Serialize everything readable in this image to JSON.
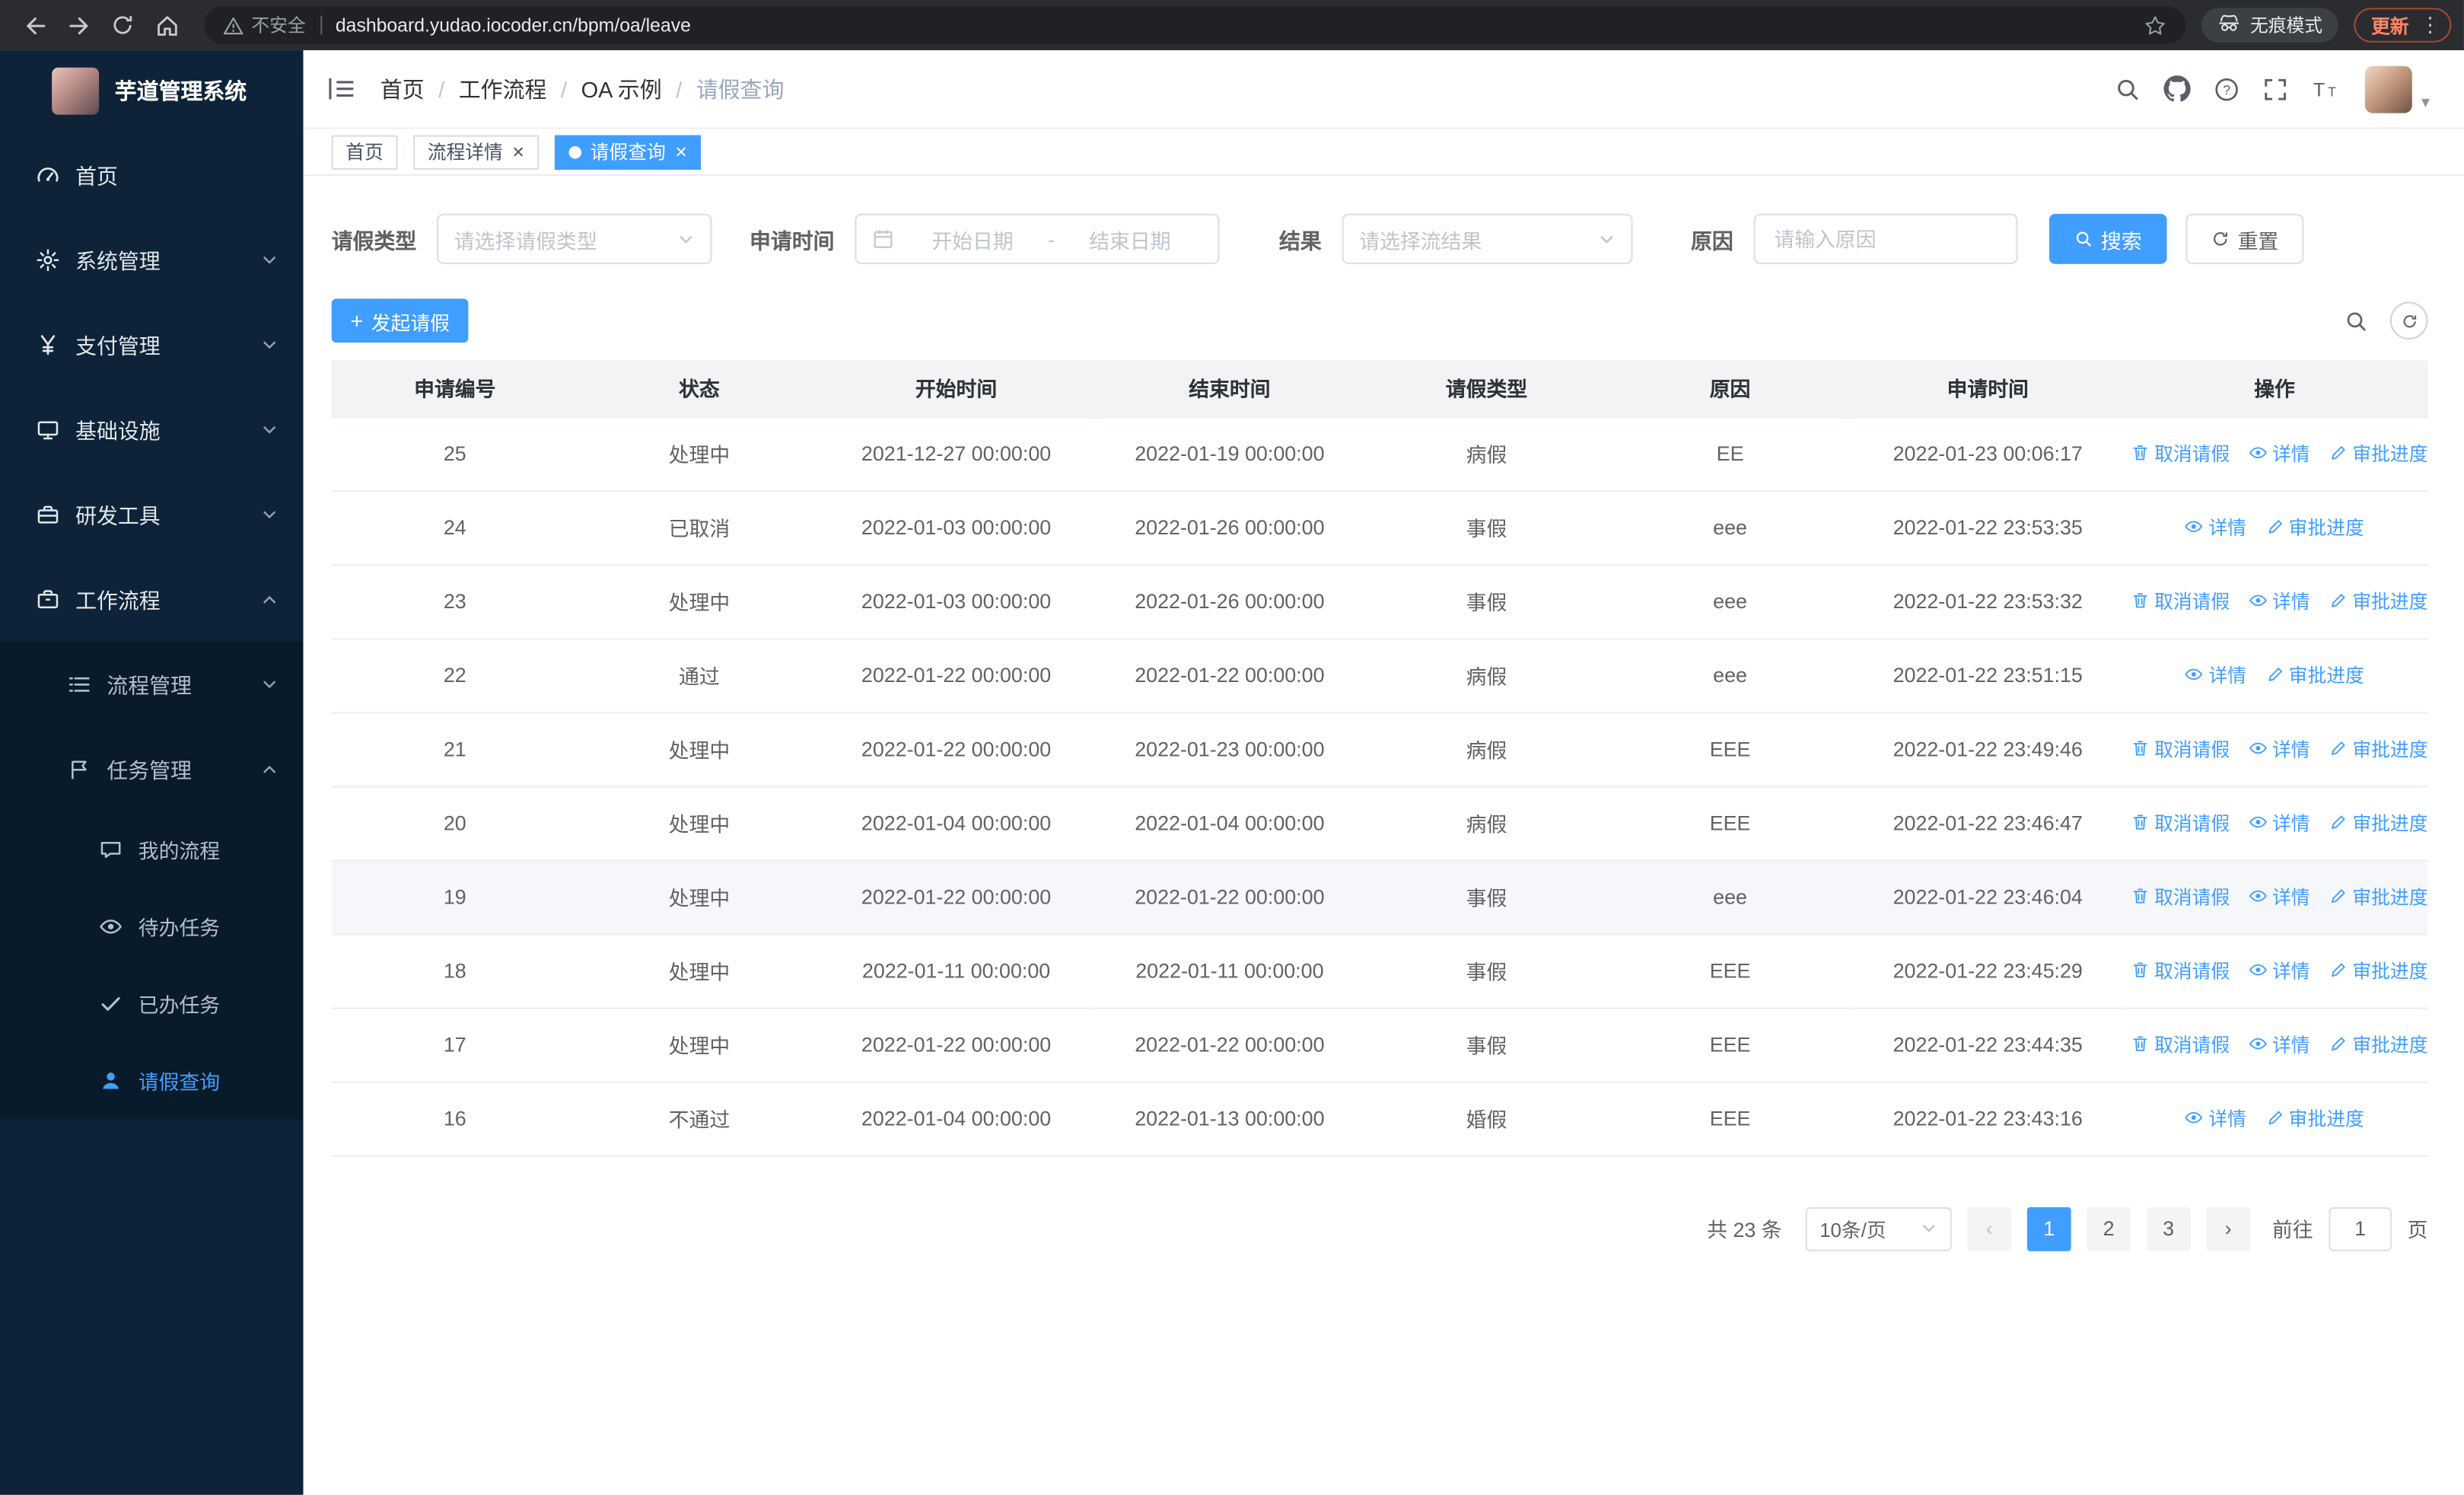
{
  "browser": {
    "security_label": "不安全",
    "url": "dashboard.yudao.iocoder.cn/bpm/oa/leave",
    "incognito_label": "无痕模式",
    "update_label": "更新"
  },
  "sidebar": {
    "logo_title": "芋道管理系统",
    "items": [
      {
        "name": "home",
        "label": "首页",
        "icon": "dashboard-icon",
        "level": 1
      },
      {
        "name": "system",
        "label": "系统管理",
        "icon": "gear-icon",
        "level": 1,
        "chevron": "down"
      },
      {
        "name": "payment",
        "label": "支付管理",
        "icon": "yen-icon",
        "level": 1,
        "chevron": "down"
      },
      {
        "name": "infrastructure",
        "label": "基础设施",
        "icon": "infra-icon",
        "level": 1,
        "chevron": "down"
      },
      {
        "name": "dev-tools",
        "label": "研发工具",
        "icon": "toolbox-icon",
        "level": 1,
        "chevron": "down"
      },
      {
        "name": "workflow",
        "label": "工作流程",
        "icon": "briefcase-icon",
        "level": 1,
        "chevron": "up"
      },
      {
        "name": "process-mgmt",
        "label": "流程管理",
        "icon": "list-icon",
        "level": 2,
        "chevron": "down"
      },
      {
        "name": "task-mgmt",
        "label": "任务管理",
        "icon": "flag-icon",
        "level": 2,
        "chevron": "up"
      },
      {
        "name": "my-process",
        "label": "我的流程",
        "icon": "chat-icon",
        "level": 3
      },
      {
        "name": "todo-tasks",
        "label": "待办任务",
        "icon": "eye-icon",
        "level": 3
      },
      {
        "name": "done-tasks",
        "label": "已办任务",
        "icon": "check-icon",
        "level": 3
      },
      {
        "name": "leave-query",
        "label": "请假查询",
        "icon": "user-icon",
        "level": 3,
        "active": true
      }
    ]
  },
  "header": {
    "breadcrumb": [
      "首页",
      "工作流程",
      "OA 示例",
      "请假查询"
    ]
  },
  "tabs": [
    {
      "label": "首页",
      "closable": false,
      "active": false
    },
    {
      "label": "流程详情",
      "closable": true,
      "active": false
    },
    {
      "label": "请假查询",
      "closable": true,
      "active": true
    }
  ],
  "filters": {
    "type_label": "请假类型",
    "type_placeholder": "请选择请假类型",
    "time_label": "申请时间",
    "start_placeholder": "开始日期",
    "separator": "-",
    "end_placeholder": "结束日期",
    "result_label": "结果",
    "result_placeholder": "请选择流结果",
    "reason_label": "原因",
    "reason_placeholder": "请输入原因",
    "search_label": "搜索",
    "reset_label": "重置"
  },
  "toolbar": {
    "create_label": "发起请假"
  },
  "table": {
    "columns": [
      "申请编号",
      "状态",
      "开始时间",
      "结束时间",
      "请假类型",
      "原因",
      "申请时间",
      "操作"
    ],
    "ops": {
      "cancel": "取消请假",
      "detail": "详情",
      "progress": "审批进度"
    },
    "rows": [
      {
        "id": "25",
        "status": "处理中",
        "start": "2021-12-27 00:00:00",
        "end": "2022-01-19 00:00:00",
        "type": "病假",
        "reason": "EE",
        "applied": "2022-01-23 00:06:17",
        "cancelable": true
      },
      {
        "id": "24",
        "status": "已取消",
        "start": "2022-01-03 00:00:00",
        "end": "2022-01-26 00:00:00",
        "type": "事假",
        "reason": "eee",
        "applied": "2022-01-22 23:53:35",
        "cancelable": false
      },
      {
        "id": "23",
        "status": "处理中",
        "start": "2022-01-03 00:00:00",
        "end": "2022-01-26 00:00:00",
        "type": "事假",
        "reason": "eee",
        "applied": "2022-01-22 23:53:32",
        "cancelable": true
      },
      {
        "id": "22",
        "status": "通过",
        "start": "2022-01-22 00:00:00",
        "end": "2022-01-22 00:00:00",
        "type": "病假",
        "reason": "eee",
        "applied": "2022-01-22 23:51:15",
        "cancelable": false
      },
      {
        "id": "21",
        "status": "处理中",
        "start": "2022-01-22 00:00:00",
        "end": "2022-01-23 00:00:00",
        "type": "病假",
        "reason": "EEE",
        "applied": "2022-01-22 23:49:46",
        "cancelable": true
      },
      {
        "id": "20",
        "status": "处理中",
        "start": "2022-01-04 00:00:00",
        "end": "2022-01-04 00:00:00",
        "type": "病假",
        "reason": "EEE",
        "applied": "2022-01-22 23:46:47",
        "cancelable": true
      },
      {
        "id": "19",
        "status": "处理中",
        "start": "2022-01-22 00:00:00",
        "end": "2022-01-22 00:00:00",
        "type": "事假",
        "reason": "eee",
        "applied": "2022-01-22 23:46:04",
        "cancelable": true,
        "hovered": true
      },
      {
        "id": "18",
        "status": "处理中",
        "start": "2022-01-11 00:00:00",
        "end": "2022-01-11 00:00:00",
        "type": "事假",
        "reason": "EEE",
        "applied": "2022-01-22 23:45:29",
        "cancelable": true
      },
      {
        "id": "17",
        "status": "处理中",
        "start": "2022-01-22 00:00:00",
        "end": "2022-01-22 00:00:00",
        "type": "事假",
        "reason": "EEE",
        "applied": "2022-01-22 23:44:35",
        "cancelable": true
      },
      {
        "id": "16",
        "status": "不通过",
        "start": "2022-01-04 00:00:00",
        "end": "2022-01-13 00:00:00",
        "type": "婚假",
        "reason": "EEE",
        "applied": "2022-01-22 23:43:16",
        "cancelable": false
      }
    ]
  },
  "pagination": {
    "total_label": "共 23 条",
    "page_size_label": "10条/页",
    "prev_label": "‹",
    "pages": [
      "1",
      "2",
      "3"
    ],
    "active_page": "1",
    "next_label": "›",
    "goto_label": "前往",
    "goto_value": "1",
    "unit_label": "页"
  },
  "colors": {
    "accent": "#409eff",
    "sidebar_bg": "#0e2338",
    "submenu_bg": "#091a2b",
    "table_header_bg": "#f1f3f5",
    "update_text": "#ff8368"
  }
}
